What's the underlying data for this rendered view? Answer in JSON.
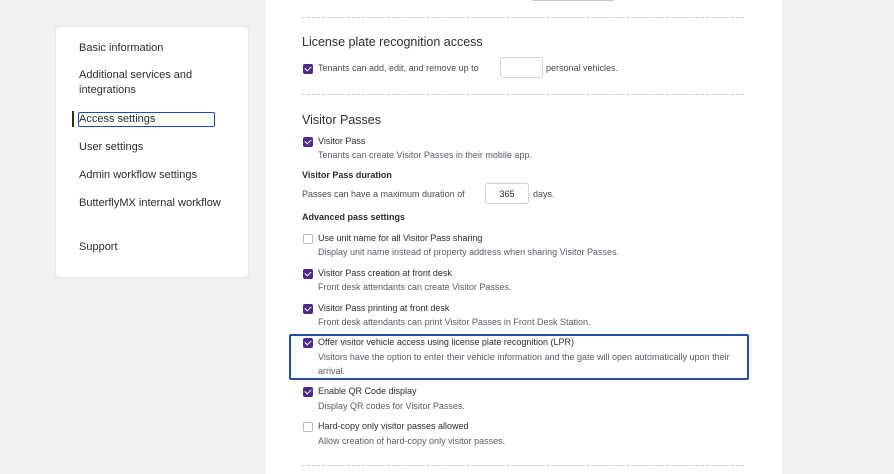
{
  "sidebar": {
    "items": [
      {
        "label": "Basic information"
      },
      {
        "label": "Additional services and integrations"
      },
      {
        "label": "Access settings"
      },
      {
        "label": "User settings"
      },
      {
        "label": "Admin workflow settings"
      },
      {
        "label": "ButterflyMX internal workflow"
      },
      {
        "label": "Support"
      }
    ]
  },
  "lpr": {
    "title": "License plate recognition access",
    "option_prefix": "Tenants can add, edit, and remove up to",
    "option_input": "",
    "option_suffix": "personal vehicles."
  },
  "visitor": {
    "title": "Visitor Passes",
    "visitor_pass": {
      "title": "Visitor Pass",
      "desc": "Tenants can create Visitor Passes in their mobile app.",
      "checked": true
    },
    "duration_title": "Visitor Pass duration",
    "duration_prefix": "Passes can have a maximum duration of",
    "duration_value": "365",
    "duration_suffix": "days.",
    "advanced_title": "Advanced pass settings",
    "options": [
      {
        "title": "Use unit name for all Visitor Pass sharing",
        "desc": "Display unit name instead of property address when sharing Visitor Passes.",
        "checked": false
      },
      {
        "title": "Visitor Pass creation at front desk",
        "desc": "Front desk attendants can create Visitor Passes.",
        "checked": true
      },
      {
        "title": "Visitor Pass printing at front desk",
        "desc": "Front desk attendants can print Visitor Passes in Front Desk Station.",
        "checked": true
      },
      {
        "title": "Offer visitor vehicle access using license plate recognition (LPR)",
        "desc": "Visitors have the option to enter their vehicle information and the gate will open automatically upon their arrival.",
        "checked": true
      },
      {
        "title": "Enable QR Code display",
        "desc": "Display QR codes for Visitor Passes.",
        "checked": true
      },
      {
        "title": "Hard-copy only visitor passes allowed",
        "desc": "Allow creation of hard-copy only visitor passes.",
        "checked": false
      }
    ]
  },
  "colors": {
    "accent": "#4b2a8a",
    "focus": "#1f4fa8"
  }
}
